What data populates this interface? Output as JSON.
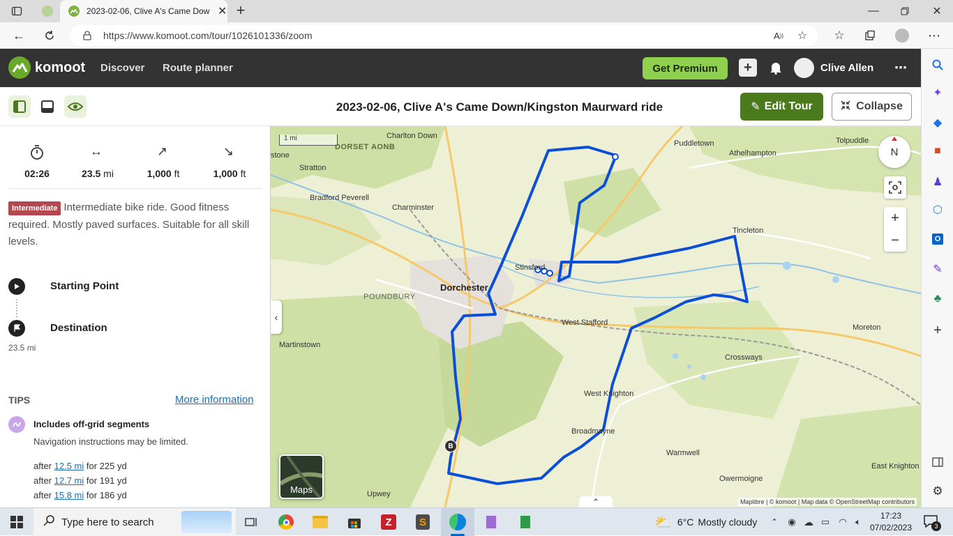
{
  "browser": {
    "tab_title": "2023-02-06, Clive A's Came Dow",
    "url": "https://www.komoot.com/tour/1026101336/zoom"
  },
  "header": {
    "brand": "komoot",
    "nav_discover": "Discover",
    "nav_route_planner": "Route planner",
    "premium_label": "Get Premium",
    "user_name": "Clive Allen"
  },
  "tour": {
    "title": "2023-02-06, Clive A's Came Down/Kingston Maurward ride",
    "edit_label": "Edit Tour",
    "collapse_label": "Collapse"
  },
  "stats": {
    "duration": "02:26",
    "distance": "23.5",
    "distance_unit": "mi",
    "elev_up": "1,000",
    "elev_up_unit": "ft",
    "elev_down": "1,000",
    "elev_down_unit": "ft"
  },
  "difficulty": {
    "badge": "Intermediate",
    "description": "Intermediate bike ride. Good fitness required. Mostly paved surfaces. Suitable for all skill levels."
  },
  "waypoints": {
    "start_label": "Starting Point",
    "destination_label": "Destination",
    "destination_distance": "23.5 mi"
  },
  "tips": {
    "heading": "TIPS",
    "more_info": "More information",
    "offgrid_title": "Includes off-grid segments",
    "offgrid_desc": "Navigation instructions may be limited.",
    "segments": [
      {
        "after": "after",
        "link": "12.5 mi",
        "rest": "for 225 yd"
      },
      {
        "after": "after",
        "link": "12.7 mi",
        "rest": "for 191 yd"
      },
      {
        "after": "after",
        "link": "15.8 mi",
        "rest": "for 186 yd"
      }
    ]
  },
  "map": {
    "scale_label": "1 mi",
    "compass": "N",
    "maps_button": "Maps",
    "attribution": "Maplibre | © komoot | Map data © OpenStreetMap contributors",
    "marker_b": "B",
    "places": [
      {
        "name": "Charlton Down"
      },
      {
        "name": "DORSET AONB"
      },
      {
        "name": "stone"
      },
      {
        "name": "Stratton"
      },
      {
        "name": "Bradford Peverell"
      },
      {
        "name": "Charminster"
      },
      {
        "name": "Puddletown"
      },
      {
        "name": "Athelhampton"
      },
      {
        "name": "Tolpuddle"
      },
      {
        "name": "Tincleton"
      },
      {
        "name": "Stinsford"
      },
      {
        "name": "Dorchester"
      },
      {
        "name": "POUNDBURY"
      },
      {
        "name": "West Stafford"
      },
      {
        "name": "Moreton"
      },
      {
        "name": "Martinstown"
      },
      {
        "name": "Crossways"
      },
      {
        "name": "West Knighton"
      },
      {
        "name": "Broadmayne"
      },
      {
        "name": "Warmwell"
      },
      {
        "name": "Owermoigne"
      },
      {
        "name": "East Knighton"
      },
      {
        "name": "Upwey"
      }
    ]
  },
  "taskbar": {
    "search_placeholder": "Type here to search",
    "weather_temp": "6°C",
    "weather_desc": "Mostly cloudy",
    "time": "17:23",
    "date": "07/02/2023",
    "notif_count": "3"
  },
  "colors": {
    "route": "#0b4fd6",
    "premium": "#8fd14f",
    "edit": "#4a7a1c",
    "header_bg": "#333333",
    "badge": "#b5484f"
  }
}
